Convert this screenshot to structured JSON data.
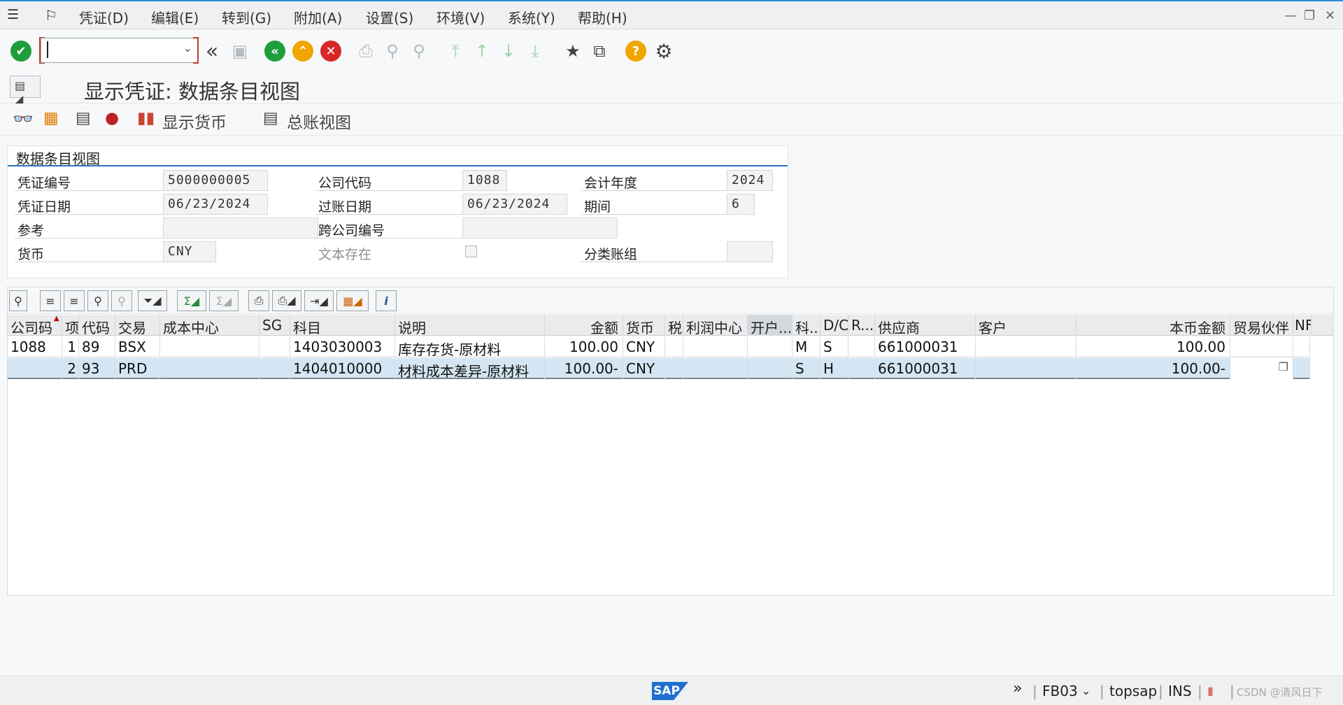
{
  "menu": {
    "items": [
      "凭证(D)",
      "编辑(E)",
      "转到(G)",
      "附加(A)",
      "设置(S)",
      "环境(V)",
      "系统(Y)",
      "帮助(H)"
    ]
  },
  "toolbar": {
    "command_value": ""
  },
  "title": {
    "text": "显示凭证: 数据条目视图"
  },
  "app_toolbar": {
    "display_currency": "显示货币",
    "gl_view": "总账视图"
  },
  "header": {
    "section_title": "数据条目视图",
    "doc_no_label": "凭证编号",
    "doc_no": "5000000005",
    "company_code_label": "公司代码",
    "company_code": "1088",
    "fiscal_year_label": "会计年度",
    "fiscal_year": "2024",
    "doc_date_label": "凭证日期",
    "doc_date": "06/23/2024",
    "posting_date_label": "过账日期",
    "posting_date": "06/23/2024",
    "period_label": "期间",
    "period": "6",
    "reference_label": "参考",
    "reference": "",
    "cross_cc_label": "跨公司编号",
    "cross_cc": "",
    "currency_label": "货币",
    "currency": "CNY",
    "text_exists_label": "文本存在",
    "ledger_group_label": "分类账组",
    "ledger_group": ""
  },
  "grid": {
    "toolbar": {
      "sum_label": "Σ",
      "info_label": "i"
    },
    "columns": [
      "公司码",
      "项",
      "代码",
      "交易",
      "成本中心",
      "SG",
      "科目",
      "说明",
      "金额",
      "货币",
      "税",
      "利润中心",
      "开户...",
      "科...",
      "D/C",
      "R...",
      "供应商",
      "客户",
      "本币金额",
      "贸易伙伴",
      "NF"
    ],
    "rows": [
      {
        "company": "1088",
        "item": "1",
        "pk": "89",
        "trans": "BSX",
        "cost_center": "",
        "sg": "",
        "account": "1403030003",
        "text": "库存存货-原材料",
        "amount": "100.00",
        "currency": "CNY",
        "tax": "",
        "profit_center": "",
        "bank": "",
        "acct_type": "M",
        "dc": "S",
        "r": "",
        "vendor": "661000031",
        "customer": "",
        "lc_amount": "100.00",
        "partner": "",
        "nf": ""
      },
      {
        "company": "",
        "item": "2",
        "pk": "93",
        "trans": "PRD",
        "cost_center": "",
        "sg": "",
        "account": "1404010000",
        "text": "材料成本差异-原材料",
        "amount": "100.00-",
        "currency": "CNY",
        "tax": "",
        "profit_center": "",
        "bank": "",
        "acct_type": "S",
        "dc": "H",
        "r": "",
        "vendor": "661000031",
        "customer": "",
        "lc_amount": "100.00-",
        "partner": "",
        "nf": ""
      }
    ]
  },
  "status": {
    "logo": "SAP",
    "tcode": "FB03",
    "system": "topsap",
    "mode": "INS",
    "watermark": "CSDN @清风日下"
  }
}
